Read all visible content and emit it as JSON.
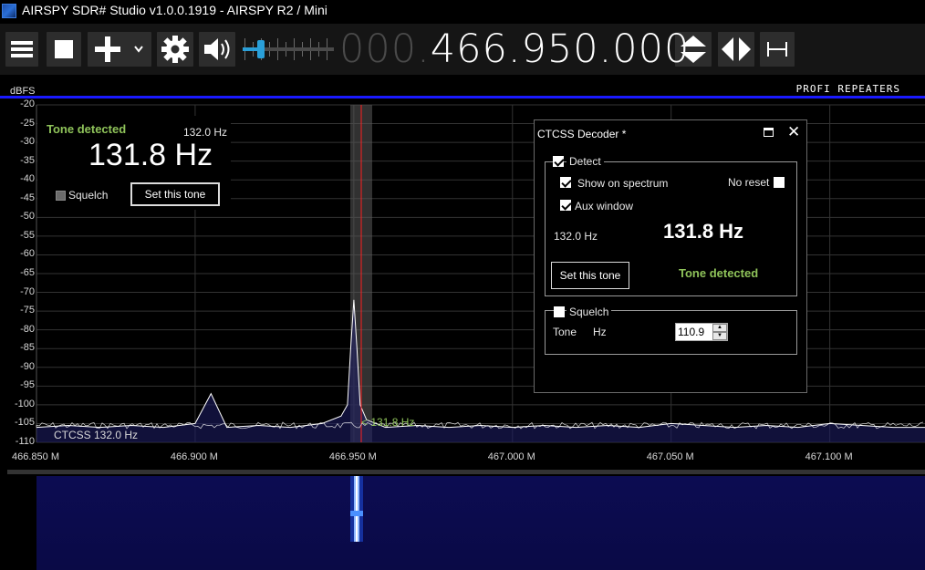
{
  "window": {
    "title": "AIRSPY SDR# Studio v1.0.0.1919 - AIRSPY R2 / Mini"
  },
  "toolbar": {
    "menu_icon": "hamburger-icon",
    "stop_icon": "stop-icon",
    "add_icon": "plus-icon",
    "dropdown_icon": "chevron-down-icon",
    "settings_icon": "gear-icon",
    "audio_icon": "speaker-icon",
    "volume_level": 0.2,
    "frequency_dim": "000.",
    "frequency_lit": "466.950.000",
    "tune_step_icon": "up-down-arrows-icon",
    "tune_icon": "left-right-arrows-icon",
    "span_icon": "span-width-icon"
  },
  "spectrum": {
    "y_axis_label": "dBFS",
    "band_label": "PROFI REPEATERS",
    "ctcss_overlay": "CTCSS  132.0 Hz",
    "peak_label": "< 131.8 Hz",
    "colors": {
      "accent": "#1a1aff",
      "tuning_line": "#ff2020",
      "tone_green": "#8fc35a"
    }
  },
  "aux_window": {
    "status": "Tone detected",
    "nominal": "132.0 Hz",
    "value": "131.8 Hz",
    "squelch_label": "Squelch",
    "set_button": "Set this tone"
  },
  "decoder": {
    "title": "CTCSS Decoder *",
    "detect_label": "Detect",
    "detect_checked": true,
    "show_on_spectrum_label": "Show on spectrum",
    "show_on_spectrum_checked": true,
    "aux_window_label": "Aux window",
    "aux_window_checked": true,
    "no_reset_label": "No reset",
    "no_reset_checked": false,
    "nominal": "132.0 Hz",
    "value": "131.8 Hz",
    "set_button": "Set this tone",
    "status": "Tone detected",
    "squelch_label": "Squelch",
    "squelch_checked": false,
    "tone_label": "Tone",
    "hz_label": "Hz",
    "tone_value": "110.9"
  },
  "chart_data": {
    "type": "line",
    "ylabel": "dBFS",
    "ylim": [
      -110,
      -20
    ],
    "xlim": [
      466.85,
      467.13
    ],
    "y_ticks": [
      "-20",
      "-25",
      "-30",
      "-35",
      "-40",
      "-45",
      "-50",
      "-55",
      "-60",
      "-65",
      "-70",
      "-75",
      "-80",
      "-85",
      "-90",
      "-95",
      "-100",
      "-105",
      "-110"
    ],
    "x_ticks": [
      "466.850 M",
      "466.900 M",
      "466.950 M",
      "467.000 M",
      "467.050 M",
      "467.100 M"
    ],
    "grid": true,
    "series": [
      {
        "x": [
          466.85,
          466.86,
          466.87,
          466.88,
          466.89,
          466.9,
          466.905,
          466.91,
          466.92,
          466.93,
          466.94,
          466.946,
          466.948,
          466.949,
          466.95,
          466.951,
          466.952,
          466.954,
          466.96,
          466.97,
          466.98,
          466.99,
          467.0,
          467.01,
          467.02,
          467.03,
          467.04,
          467.05,
          467.06,
          467.07,
          467.08,
          467.09,
          467.1,
          467.11,
          467.12,
          467.13
        ],
        "y": [
          -106,
          -105.5,
          -106,
          -105.5,
          -106,
          -105,
          -97,
          -106,
          -105.5,
          -106,
          -105,
          -103,
          -100,
          -85,
          -72,
          -85,
          -100,
          -104,
          -106,
          -105.5,
          -106,
          -105.5,
          -106,
          -105.5,
          -106,
          -105.5,
          -106,
          -105,
          -105.5,
          -106,
          -105.5,
          -106,
          -105,
          -105.5,
          -106,
          -106
        ]
      }
    ]
  }
}
